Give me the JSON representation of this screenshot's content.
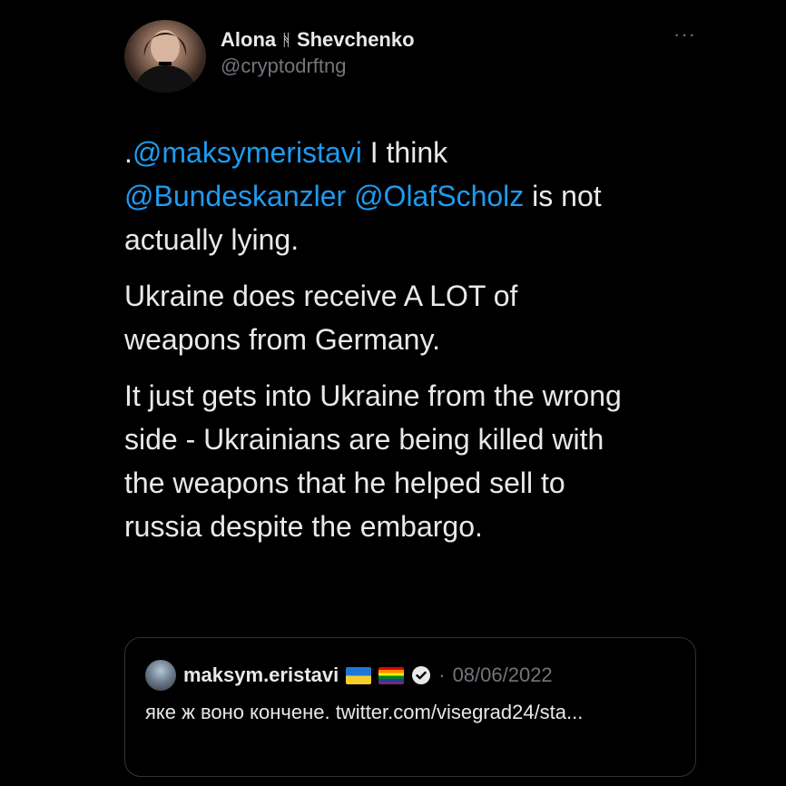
{
  "author": {
    "name_first": "Alona",
    "name_glyph": "ᚻ",
    "name_last": "Shevchenko",
    "handle": "@cryptodrftng"
  },
  "more_label": "···",
  "tweet": {
    "p1_prefix": ".",
    "p1_mention1": "@maksymeristavi",
    "p1_text1": " I think",
    "p1_mention2": "@Bundeskanzler",
    "p1_space": " ",
    "p1_mention3": "@OlafScholz",
    "p1_text2": " is not actually lying.",
    "p2": "Ukraine does receive A LOT of weapons from Germany.",
    "p3": "It just gets into Ukraine from the wrong side - Ukrainians are being killed with the weapons that he helped sell to russia despite the embargo."
  },
  "quote": {
    "name": "maksym.eristavi",
    "separator": "·",
    "date": "08/06/2022",
    "text": "яке ж воно кончене. twitter.com/visegrad24/sta..."
  },
  "icons": {
    "avatar": "avatar-photo",
    "verified": "verified-badge-icon",
    "more": "more-options-icon"
  },
  "colors": {
    "background": "#000000",
    "text": "#e7e9ea",
    "secondary": "#71767b",
    "link": "#1d9bf0",
    "border": "#2f3336"
  }
}
